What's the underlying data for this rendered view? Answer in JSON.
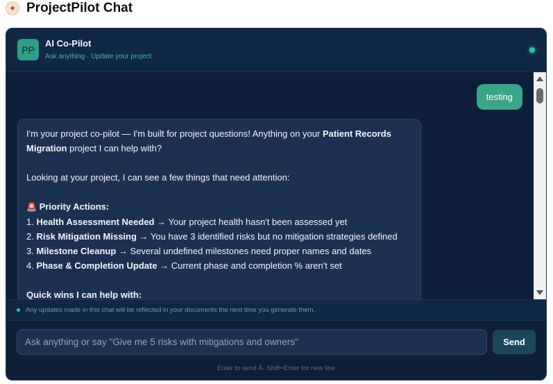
{
  "page": {
    "title": "ProjectPilot Chat",
    "logo_icon": "compass-icon"
  },
  "chat": {
    "bot": {
      "avatar_initials": "PP",
      "name": "AI Co-Pilot",
      "subtitle": "Ask anything · Update your project",
      "status_color": "#2ec4a0"
    },
    "user_message": "testing",
    "bot_message": {
      "line1_a": "I'm your project co-pilot — I'm built for project questions! Anything on your ",
      "project_name": "Patient Records Migration",
      "line1_b": " project I can help with?",
      "intro": "Looking at your project, I can see a few things that need attention:",
      "priority_icon": "siren-icon",
      "priority_heading": "Priority Actions:",
      "items": [
        {
          "num": "1. ",
          "title": "Health Assessment Needed",
          "text": " → Your project health hasn't been assessed yet"
        },
        {
          "num": "2. ",
          "title": "Risk Mitigation Missing",
          "text": " → You have 3 identified risks but no mitigation strategies defined"
        },
        {
          "num": "3. ",
          "title": "Milestone Cleanup",
          "text": " → Several undefined milestones need proper names and dates"
        },
        {
          "num": "4. ",
          "title": "Phase & Completion Update",
          "text": " → Current phase and completion % aren't set"
        }
      ],
      "quick_wins_heading": "Quick wins I can help with:"
    },
    "notice": "Any updates made in this chat will be reflected in your documents the next time you generate them.",
    "input": {
      "value": "",
      "placeholder": "Ask anything or say \"Give me 5 risks with mitigations and owners\""
    },
    "send_label": "Send",
    "hint": "Enter to send Â· Shift+Enter for new line"
  },
  "colors": {
    "accent": "#3aa58a",
    "background": "#0e2038",
    "bubble": "#1c3150"
  }
}
